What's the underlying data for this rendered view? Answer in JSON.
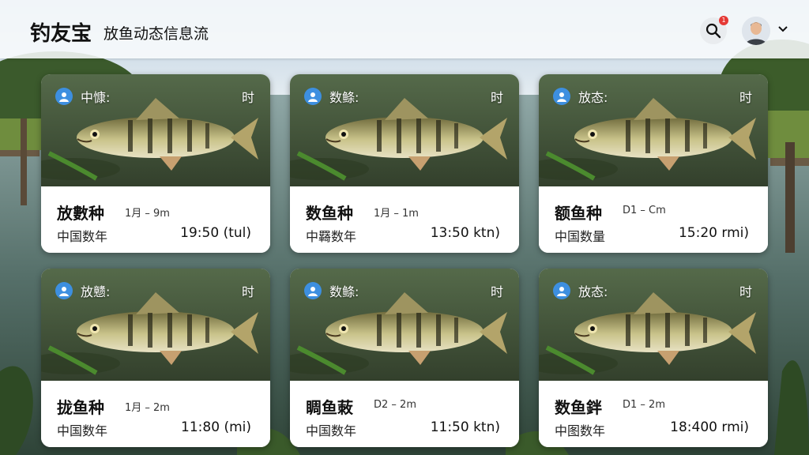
{
  "header": {
    "app_title": "钓友宝",
    "page_subtitle": "放鱼动态信息流",
    "notification_count": "1"
  },
  "colors": {
    "accent": "#3d8fe0",
    "badge": "#e53935",
    "header_bg": "#f8fafc"
  },
  "icons": {
    "search": "search-icon",
    "user": "user-icon",
    "profile": "avatar",
    "menu": "chevron-down-icon"
  },
  "cards": [
    {
      "tag": "中慷:",
      "time_tag": "时",
      "title": "放數种",
      "size": "1月 – 9m",
      "location": "中国数年",
      "time": "19:50 (tul)"
    },
    {
      "tag": "数鲦:",
      "time_tag": "时",
      "title": "数鱼种",
      "size": "1月 – 1m",
      "location": "中羇数年",
      "time": "13:50 ktn)"
    },
    {
      "tag": "放态:",
      "time_tag": "时",
      "title": "额鱼种",
      "size": "D1 – Cm",
      "location": "中国数量",
      "time": "15:20 rmi)"
    },
    {
      "tag": "放戆:",
      "time_tag": "时",
      "title": "拢鱼种",
      "size": "1月 – 2m",
      "location": "中国数年",
      "time": "11:80 (mi)"
    },
    {
      "tag": "数鲦:",
      "time_tag": "时",
      "title": "睭鱼蓛",
      "size": "D2 – 2m",
      "location": "中国数年",
      "time": "11:50 ktn)"
    },
    {
      "tag": "放态:",
      "time_tag": "时",
      "title": "数鱼鉡",
      "size": "D1 – 2m",
      "location": "中图数年",
      "time": "18:400 rmi)"
    }
  ]
}
